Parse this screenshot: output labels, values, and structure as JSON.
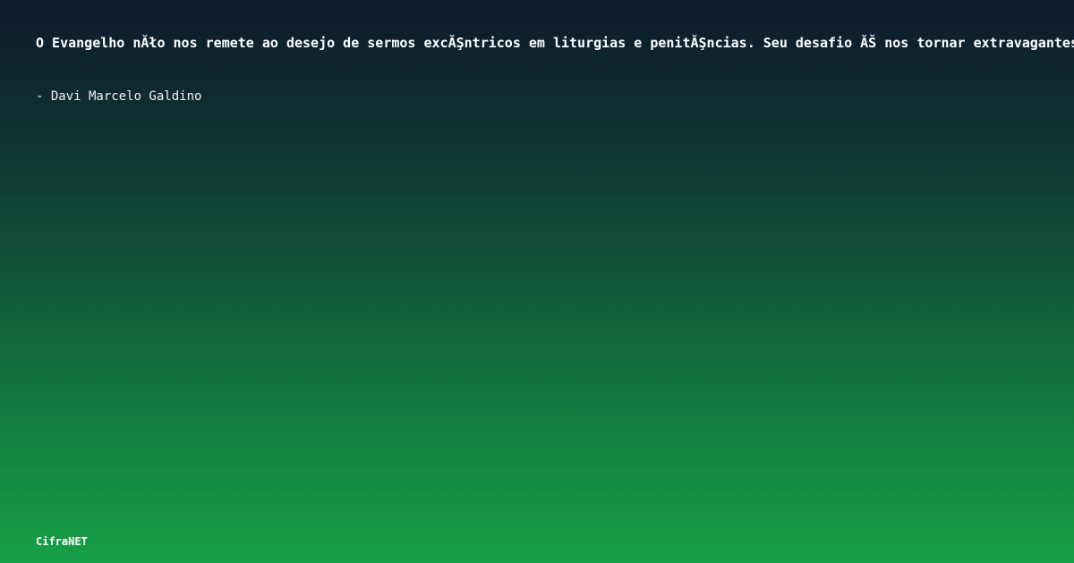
{
  "quote": {
    "text": "O Evangelho nĂło nos remete ao desejo de sermos excĂŞntricos em liturgias e penitĂŞncias. Seu desafio ĂŠ nos tornar extravagantes no amor e na misericĂłrdia."
  },
  "author": {
    "text": "- Davi Marcelo Galdino"
  },
  "brand": {
    "name": "CifraNET"
  },
  "colors": {
    "gradient_top": "#0e1a2d",
    "gradient_bottom": "#16a047",
    "text": "#ffffff"
  }
}
